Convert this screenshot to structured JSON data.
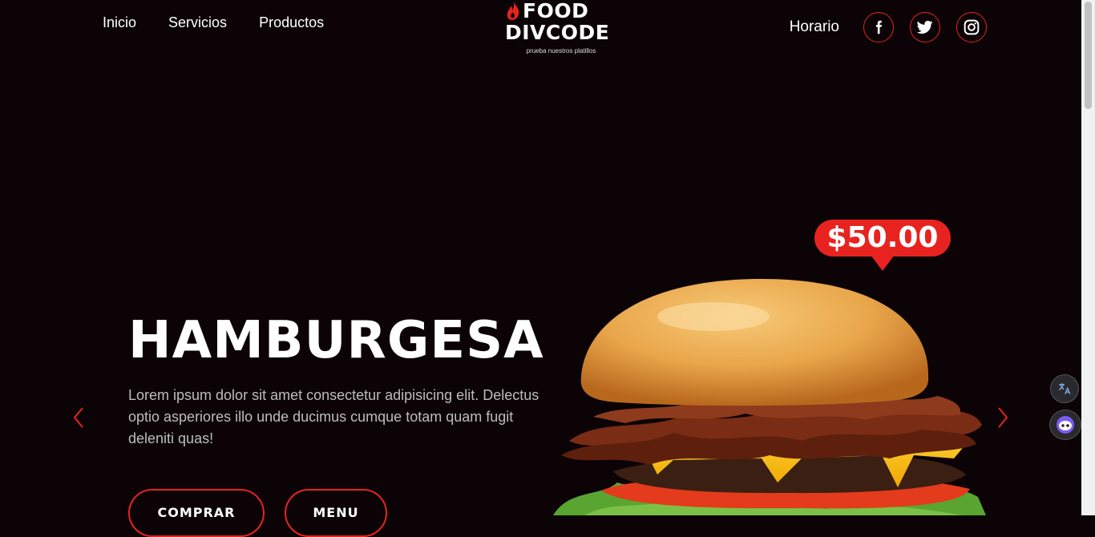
{
  "nav": {
    "links": [
      "Inicio",
      "Servicios",
      "Productos"
    ],
    "horario": "Horario"
  },
  "logo": {
    "line1": "FOOD",
    "line2": "DIVCODE",
    "tagline": "prueba nuestros platillos"
  },
  "social": [
    "facebook-icon",
    "twitter-icon",
    "instagram-icon"
  ],
  "hero": {
    "title": "HAMBURGESA",
    "description": "Lorem ipsum dolor sit amet consectetur adipisicing elit. Delectus optio asperiores illo unde ducimus cumque totam quam fugit deleniti quas!",
    "price": "$50.00",
    "buttons": {
      "buy": "COMPRAR",
      "menu": "MENU"
    }
  },
  "colors": {
    "accent": "#e8231f",
    "background": "#0b0306"
  }
}
